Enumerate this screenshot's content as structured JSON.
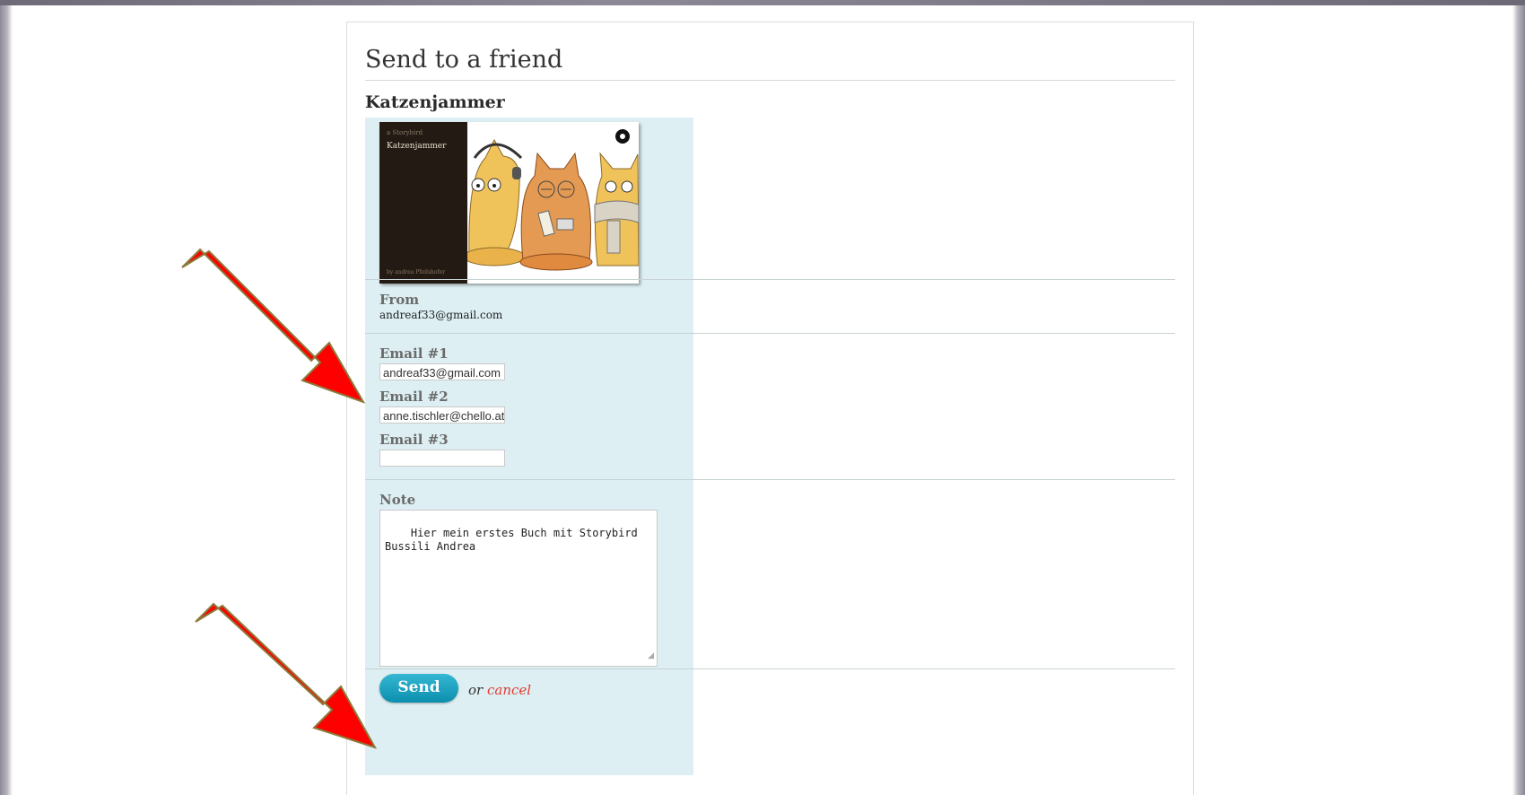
{
  "page": {
    "title": "Send to a friend",
    "book_title": "Katzenjammer"
  },
  "cover": {
    "series_label": "a Storybird",
    "title": "Katzenjammer",
    "author_line": "by andrea Pfeilshofer"
  },
  "from": {
    "label": "From",
    "value": "andreaf33@gmail.com"
  },
  "emails": [
    {
      "label": "Email #1",
      "value": "andreaf33@gmail.com"
    },
    {
      "label": "Email #2",
      "value": "anne.tischler@chello.at"
    },
    {
      "label": "Email #3",
      "value": ""
    }
  ],
  "note": {
    "label": "Note",
    "value": "Hier mein erstes Buch mit Storybird\nBussili Andrea"
  },
  "actions": {
    "send_label": "Send",
    "or_text": "or",
    "cancel_label": "cancel"
  },
  "colors": {
    "panel_blue": "#ddeff3",
    "send_button": "#1aa3c2",
    "cancel_link": "#e13a2f",
    "annotation_arrow": "#ff0000"
  }
}
